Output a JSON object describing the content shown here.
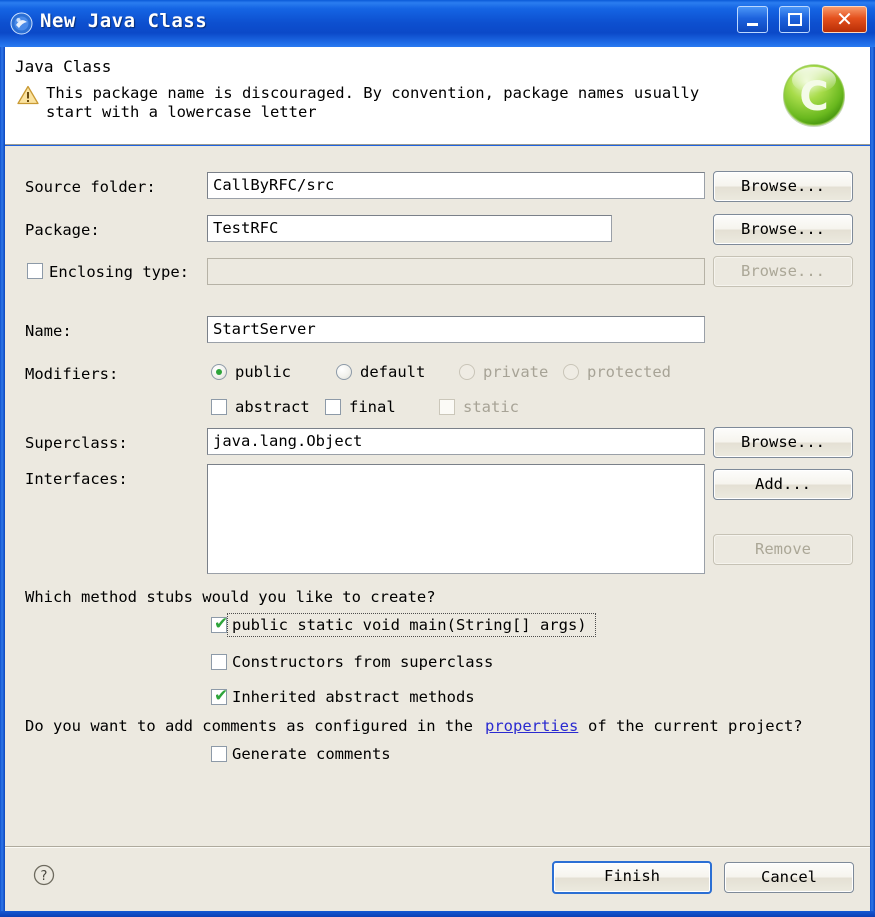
{
  "window": {
    "title": "New Java Class",
    "icon": "eclipse-wizard-icon",
    "minimize_label": "Minimize",
    "maximize_label": "Maximize",
    "close_label": "Close",
    "close_glyph": "✕"
  },
  "header": {
    "title": "Java Class",
    "message": "This package name is discouraged. By convention, package names usually start with a lowercase letter",
    "warning_icon": "warning-triangle-icon",
    "logo_icon": "green-c-logo",
    "logo_letter": "C"
  },
  "fields": {
    "source_folder": {
      "label": "Source folder:",
      "value": "CallByRFC/src",
      "button": "Browse..."
    },
    "package": {
      "label": "Package:",
      "value": "TestRFC",
      "button": "Browse..."
    },
    "enclosing_type": {
      "label": "Enclosing type:",
      "value": "",
      "button": "Browse...",
      "checked": false,
      "enabled": false
    },
    "name": {
      "label": "Name:",
      "value": "StartServer"
    },
    "superclass": {
      "label": "Superclass:",
      "value": "java.lang.Object",
      "button": "Browse..."
    },
    "interfaces": {
      "label": "Interfaces:",
      "values": [],
      "add_button": "Add...",
      "remove_button": "Remove"
    }
  },
  "modifiers": {
    "label": "Modifiers:",
    "radios": [
      {
        "label": "public",
        "selected": true,
        "enabled": true
      },
      {
        "label": "default",
        "selected": false,
        "enabled": true
      },
      {
        "label": "private",
        "selected": false,
        "enabled": false
      },
      {
        "label": "protected",
        "selected": false,
        "enabled": false
      }
    ],
    "checkboxes": [
      {
        "label": "abstract",
        "checked": false,
        "enabled": true
      },
      {
        "label": "final",
        "checked": false,
        "enabled": true
      },
      {
        "label": "static",
        "checked": false,
        "enabled": false
      }
    ]
  },
  "stubs": {
    "question": "Which method stubs would you like to create?",
    "items": [
      {
        "label": "public static void main(String[] args)",
        "checked": true,
        "focused": true
      },
      {
        "label": "Constructors from superclass",
        "checked": false,
        "focused": false
      },
      {
        "label": "Inherited abstract methods",
        "checked": true,
        "focused": false
      }
    ]
  },
  "comments": {
    "question_before": "Do you want to add comments as configured in the ",
    "link": "properties",
    "question_after": " of the current project?",
    "checkbox": {
      "label": "Generate comments",
      "checked": false
    }
  },
  "footer": {
    "help_icon": "help-question-icon",
    "finish_button": "Finish",
    "cancel_button": "Cancel"
  },
  "colors": {
    "titlebar_blue": "#1565e4",
    "dialog_background": "#ece9e0",
    "field_background": "#ffffff",
    "accent_green": "#2ea43a",
    "link_blue": "#2a2ad0",
    "default_button_border": "#2b6fd4",
    "disabled_text": "#a7a396"
  }
}
